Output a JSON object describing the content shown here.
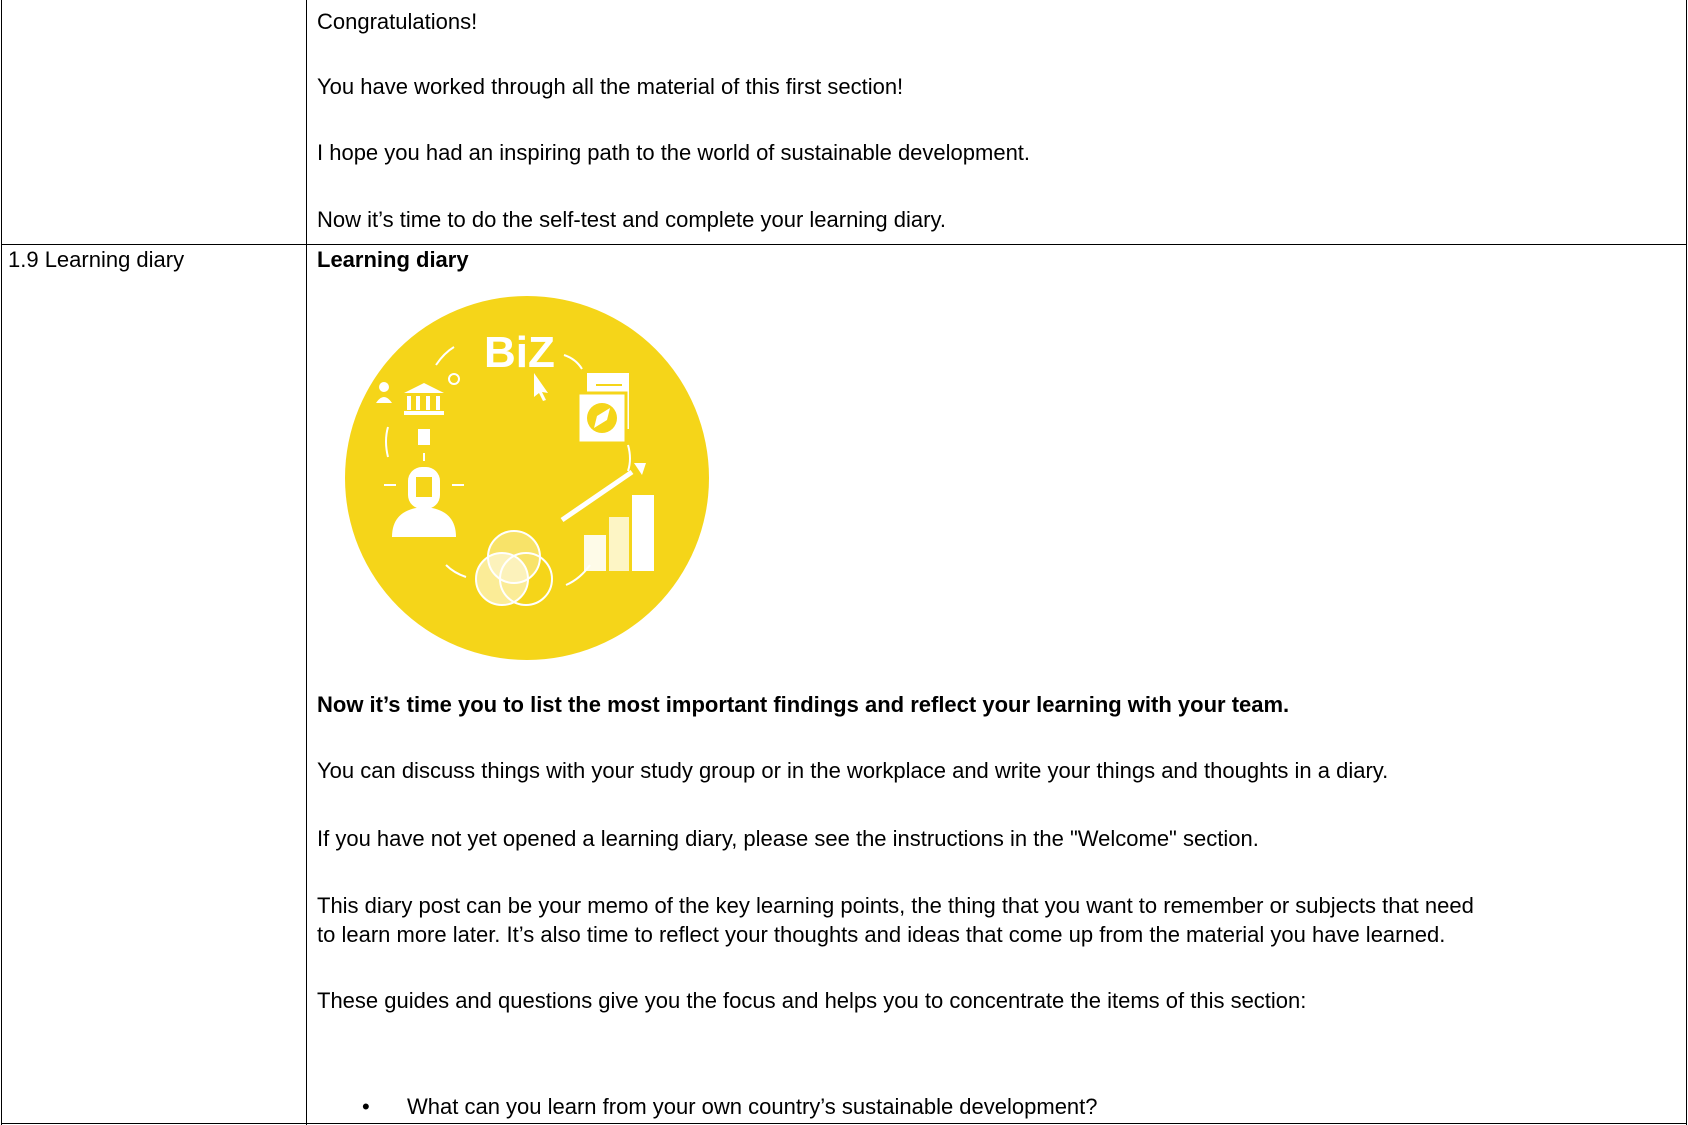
{
  "row1": {
    "left_cell": "",
    "paragraphs": [
      "Congratulations!",
      "You have worked through all the material of this first section!",
      "I hope you had an inspiring path to the world of sustainable development.",
      "Now it’s time to do the self-test and complete your learning diary."
    ]
  },
  "row2": {
    "left_cell": "1.9 Learning diary",
    "heading": "Learning diary",
    "image": {
      "logo_text": "BiZ",
      "background_color": "#F5D519"
    },
    "lead": "Now it’s time you to list the most important findings and reflect your learning with your team.",
    "paragraphs": [
      "You can discuss things with your study group or in the workplace and write your things and thoughts in a diary.",
      "If you have not yet opened a learning diary, please see the instructions in the \"Welcome\" section.",
      "This diary post can be your memo of the key learning points, the thing that you want to remember or subjects that need",
      "to learn more later. It’s also time to reflect your thoughts and ideas that come up from the material you have learned.",
      "These guides and questions give you the focus and helps you to concentrate the items of this section:"
    ],
    "bullets": [
      "What can you learn from your own country’s sustainable development?"
    ]
  }
}
